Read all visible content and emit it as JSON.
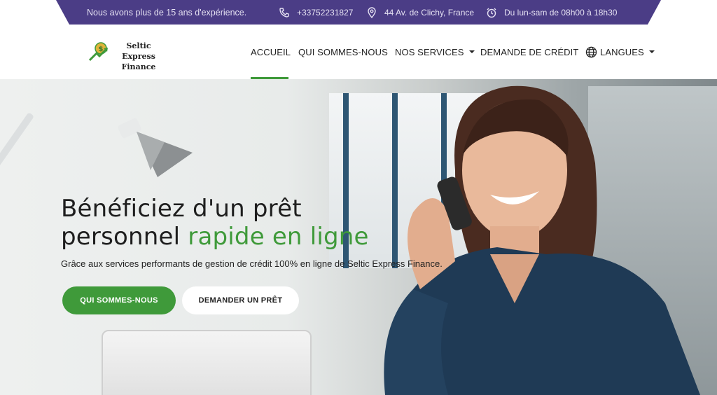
{
  "topbar": {
    "experience": "Nous avons plus de 15 ans d'expérience.",
    "phone": "+33752231827",
    "address": "44 Av. de Clichy, France",
    "hours": "Du lun-sam de 08h00 à 18h30",
    "background_color": "#4b3d86"
  },
  "logo": {
    "line1": "Seltic Express",
    "line2": "Finance"
  },
  "nav": {
    "items": [
      {
        "label": "ACCUEIL",
        "active": true
      },
      {
        "label": "QUI SOMMES-NOUS"
      },
      {
        "label": "NOS SERVICES",
        "dropdown": true
      },
      {
        "label": "DEMANDE DE CRÉDIT"
      },
      {
        "label": "LANGUES",
        "dropdown": true,
        "icon": "globe-icon"
      }
    ],
    "accent_color": "#3f9a3a"
  },
  "hero": {
    "title_line1": "Bénéficiez d'un prêt",
    "title_line2_plain": "personnel ",
    "title_line2_accent": "rapide en ligne",
    "subtitle": "Grâce aux services performants de gestion de crédit 100% en ligne de Seltic Express Finance.",
    "primary_button": "QUI SOMMES-NOUS",
    "secondary_button": "DEMANDER UN PRÊT"
  }
}
